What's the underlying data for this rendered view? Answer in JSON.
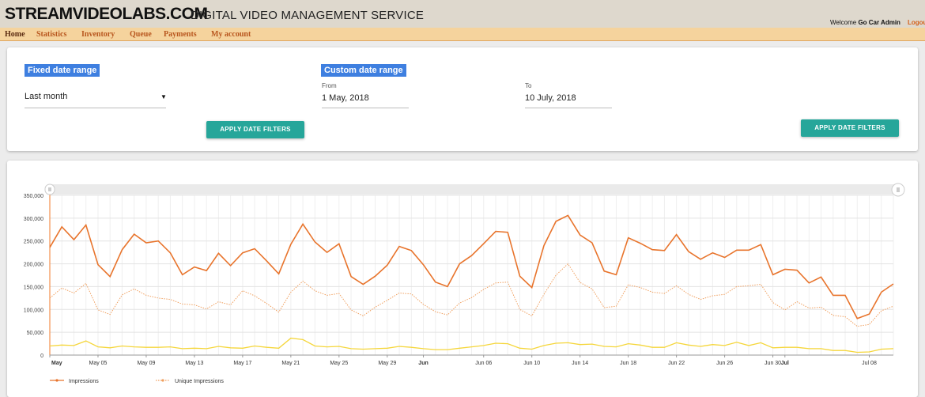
{
  "header": {
    "brand": "STREAMVIDEOLABS.COM",
    "tagline": "DIGITAL VIDEO MANAGEMENT SERVICE",
    "welcome_prefix": "Welcome",
    "user": "Go Car Admin",
    "logout": "Logou"
  },
  "nav": [
    {
      "label": "Home"
    },
    {
      "label": "Statistics"
    },
    {
      "label": "Inventory"
    },
    {
      "label": "Queue"
    },
    {
      "label": "Payments"
    },
    {
      "label": "My account"
    }
  ],
  "filters": {
    "fixed_label": "Fixed date range",
    "fixed_value": "Last month",
    "custom_label": "Custom date range",
    "from_label": "From",
    "from_value": "1 May, 2018",
    "to_label": "To",
    "to_value": "10 July, 2018",
    "apply_label": "APPLY DATE FILTERS"
  },
  "colors": {
    "impressions": "#e8742c",
    "unique": "#f0a060",
    "third": "#f5d63a",
    "apply_button": "#26a69a",
    "chip": "#3e7fe0"
  },
  "chart_data": {
    "type": "line",
    "ylim": [
      0,
      350000
    ],
    "y_ticks": [
      "0",
      "50,000",
      "100,000",
      "150,000",
      "200,000",
      "250,000",
      "300,000",
      "350,000"
    ],
    "x_ticks": [
      {
        "label": "May",
        "day": 0,
        "bold": true
      },
      {
        "label": "May 05",
        "day": 4
      },
      {
        "label": "May 09",
        "day": 8
      },
      {
        "label": "May 13",
        "day": 12
      },
      {
        "label": "May 17",
        "day": 16
      },
      {
        "label": "May 21",
        "day": 20
      },
      {
        "label": "May 25",
        "day": 24
      },
      {
        "label": "May 29",
        "day": 28
      },
      {
        "label": "Jun",
        "day": 31,
        "bold": true
      },
      {
        "label": "Jun 06",
        "day": 36
      },
      {
        "label": "Jun 10",
        "day": 40
      },
      {
        "label": "Jun 14",
        "day": 44
      },
      {
        "label": "Jun 18",
        "day": 48
      },
      {
        "label": "Jun 22",
        "day": 52
      },
      {
        "label": "Jun 26",
        "day": 56
      },
      {
        "label": "Jun 30",
        "day": 60
      },
      {
        "label": "Jul",
        "day": 61,
        "bold": true
      },
      {
        "label": "Jul 08",
        "day": 68
      }
    ],
    "series": [
      {
        "name": "Impressions",
        "style": "solid",
        "values": [
          236000,
          281000,
          253000,
          285000,
          198000,
          172000,
          231000,
          265000,
          246000,
          250000,
          224000,
          176000,
          193000,
          185000,
          223000,
          196000,
          224000,
          233000,
          206000,
          178000,
          243000,
          287000,
          248000,
          225000,
          244000,
          172000,
          155000,
          173000,
          197000,
          238000,
          229000,
          198000,
          160000,
          150000,
          200000,
          218000,
          244000,
          271000,
          269000,
          173000,
          148000,
          240000,
          293000,
          306000,
          263000,
          246000,
          184000,
          176000,
          257000,
          245000,
          231000,
          229000,
          264000,
          227000,
          210000,
          224000,
          214000,
          230000,
          230000,
          242000,
          176000,
          188000,
          186000,
          158000,
          171000,
          131000,
          131000,
          80000,
          90000,
          138000,
          156000
        ]
      },
      {
        "name": "Unique Impressions",
        "style": "dotted",
        "values": [
          125000,
          147000,
          136000,
          157000,
          99000,
          89000,
          132000,
          145000,
          131000,
          125000,
          122000,
          112000,
          110000,
          101000,
          117000,
          110000,
          141000,
          130000,
          113000,
          94000,
          138000,
          162000,
          141000,
          131000,
          135000,
          99000,
          86000,
          105000,
          120000,
          136000,
          134000,
          111000,
          95000,
          88000,
          114000,
          126000,
          144000,
          158000,
          160000,
          100000,
          86000,
          133000,
          175000,
          200000,
          159000,
          145000,
          104000,
          107000,
          154000,
          148000,
          138000,
          135000,
          152000,
          133000,
          122000,
          130000,
          133000,
          150000,
          152000,
          155000,
          115000,
          99000,
          117000,
          103000,
          105000,
          87000,
          84000,
          63000,
          67000,
          97000,
          107000
        ]
      },
      {
        "values": [
          20000,
          22000,
          21000,
          31000,
          18000,
          16000,
          20000,
          18000,
          17000,
          17000,
          18000,
          14000,
          15000,
          14000,
          19000,
          16000,
          15000,
          20000,
          17000,
          15000,
          37000,
          34000,
          20000,
          18000,
          19000,
          14000,
          13000,
          14000,
          15000,
          19000,
          17000,
          14000,
          12000,
          12000,
          15000,
          18000,
          21000,
          26000,
          25000,
          15000,
          13000,
          21000,
          26000,
          27000,
          23000,
          24000,
          19000,
          18000,
          25000,
          22000,
          17000,
          17000,
          27000,
          22000,
          19000,
          23000,
          21000,
          28000,
          21000,
          27000,
          16000,
          17000,
          17000,
          14000,
          14000,
          10000,
          10000,
          6000,
          7000,
          13000,
          14000
        ]
      }
    ],
    "legend_position": "bottom-left",
    "range_slider": true,
    "grid": true
  }
}
